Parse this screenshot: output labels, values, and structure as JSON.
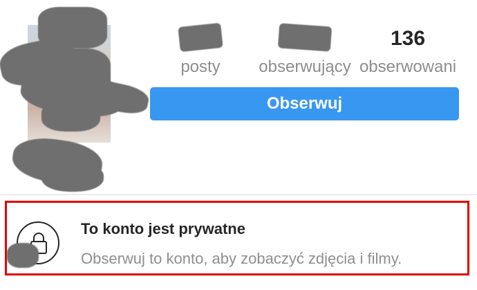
{
  "profile": {
    "stats": [
      {
        "count": "",
        "label": "posty"
      },
      {
        "count": "",
        "label": "obserwujący"
      },
      {
        "count": "136",
        "label": "obserwowani"
      }
    ],
    "follow_button_label": "Obserwuj"
  },
  "private_notice": {
    "title": "To konto jest prywatne",
    "description": "Obserwuj to konto, aby zobaczyć zdjęcia i filmy.",
    "highlight_color": "#e10000",
    "icon": "lock-icon"
  },
  "colors": {
    "follow_button": "#3897f0",
    "muted_text": "#8e8e8e",
    "primary_text": "#262626"
  }
}
